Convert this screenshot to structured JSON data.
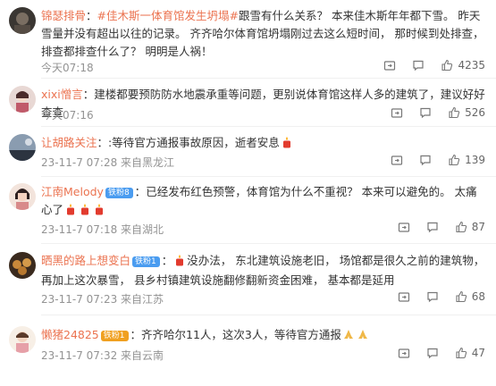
{
  "comments": [
    {
      "username": "锦瑟排骨",
      "colon": "：",
      "topic1": "#佳木斯一体育馆发生坍塌#",
      "text": "跟雪有什么关系？ 本来佳木斯年年都下雪。 昨天雪量并没有超出以往的记录。 齐齐哈尔体育馆坍塌刚过去这么短时间， 那时候到处排查， 排查都排查什么了？ 明明是人祸！",
      "time": "今天07:18",
      "likes": "4235"
    },
    {
      "username": "xixi憎言",
      "colon": "：",
      "text": "建楼都要预防防水地震承重等问题，更别说体育馆这样人多的建筑了，建议好好查查",
      "time": "今天07:16",
      "likes": "526"
    },
    {
      "username": "让胡路关注",
      "colon": "：",
      "text": ":等待官方通报事故原因，逝者安息",
      "time": "23-11-7 07:28 来自黑龙江",
      "likes": "139"
    },
    {
      "username": "江南Melody",
      "badge": "铁粉8",
      "colon": "：",
      "text": "已经发布红色预警，体育馆为什么不重视？ 本来可以避免的。 太痛心了",
      "time": "23-11-7 07:18 来自湖北",
      "likes": "87"
    },
    {
      "username": "晒黑的路上想变白",
      "badge": "铁粉1",
      "colon": "：",
      "text": "没办法， 东北建筑设施老旧， 场馆都是很久之前的建筑物， 再加上这次暴雪， 县乡村镇建筑设施翻修翻新资金困难， 基本都是延用",
      "time": "23-11-7 07:23 来自江苏",
      "likes": "68"
    },
    {
      "username": "懒猪24825",
      "badge": "铁粉1",
      "colon": "：",
      "text": "齐齐哈尔11人，这次3人，等待官方通报",
      "time": "23-11-7 07:32 来自云南",
      "likes": "47"
    }
  ],
  "colors": {
    "username": "#eb7350",
    "meta": "#939393",
    "badge": "#4a9cf0"
  },
  "icons": [
    "share-icon",
    "comment-icon",
    "like-icon",
    "candle-emoji",
    "pray-emoji"
  ]
}
